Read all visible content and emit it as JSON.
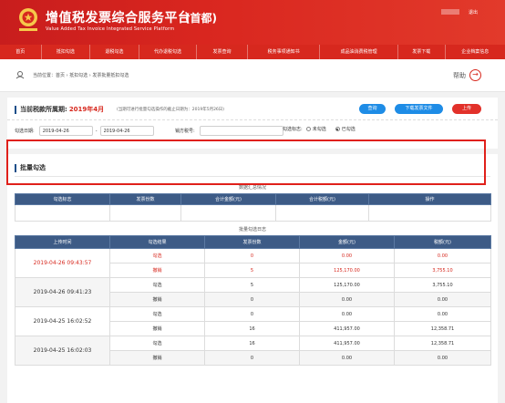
{
  "header": {
    "title": "增值税发票综合服务平台",
    "region": "(首都)",
    "subtitle": "Value Added Tax Invoice Integrated Service Platform",
    "logout": "退出"
  },
  "nav": [
    "首页",
    "抵扣勾选",
    "退税勾选",
    "代办退税勾选",
    "发票查询",
    "税务事项通知书",
    "成品油消费税管理",
    "发票下载",
    "企业档案信息"
  ],
  "breadcrumb": {
    "text": "当前位置：首页 › 抵扣勾选 › 发票批量抵扣勾选"
  },
  "help": {
    "label": "帮助"
  },
  "period": {
    "label": "当前税款所属期:",
    "value": "2019年4月",
    "note": "(当期可进行批量勾选操作的截止日期为：2019年5月26日)"
  },
  "buttons": {
    "query": "查询",
    "download": "下载发票文件",
    "upload": "上传"
  },
  "filters": {
    "date_label": "勾选日期:",
    "date_from": "2019-04-26",
    "date_to": "2019-04-26",
    "seller_label": "销方税号:",
    "flag_label": "勾选标志:",
    "opt_unchecked": "未勾选",
    "opt_checked": "已勾选"
  },
  "section": {
    "title": "批量勾选"
  },
  "summary": {
    "caption": "数据汇总情况",
    "headers": [
      "勾选标志",
      "发票份数",
      "合计金额(元)",
      "合计税额(元)",
      "操作"
    ]
  },
  "log": {
    "caption": "批量勾选日志",
    "headers": [
      "上传时间",
      "勾选结果",
      "发票份数",
      "金额(元)",
      "税额(元)"
    ],
    "groups": [
      {
        "time": "2019-04-26 09:43:57",
        "rows": [
          {
            "result": "勾选",
            "count": "0",
            "amount": "0.00",
            "tax": "0.00"
          },
          {
            "result": "撤销",
            "count": "5",
            "amount": "125,170.00",
            "tax": "3,755.10"
          }
        ]
      },
      {
        "time": "2019-04-26 09:41:23",
        "rows": [
          {
            "result": "勾选",
            "count": "5",
            "amount": "125,170.00",
            "tax": "3,755.10"
          },
          {
            "result": "撤销",
            "count": "0",
            "amount": "0.00",
            "tax": "0.00"
          }
        ]
      },
      {
        "time": "2019-04-25 16:02:52",
        "rows": [
          {
            "result": "勾选",
            "count": "0",
            "amount": "0.00",
            "tax": "0.00"
          },
          {
            "result": "撤销",
            "count": "16",
            "amount": "411,957.00",
            "tax": "12,358.71"
          }
        ]
      },
      {
        "time": "2019-04-25 16:02:03",
        "rows": [
          {
            "result": "勾选",
            "count": "16",
            "amount": "411,957.00",
            "tax": "12,358.71"
          },
          {
            "result": "撤销",
            "count": "0",
            "amount": "0.00",
            "tax": "0.00"
          }
        ]
      }
    ]
  },
  "colors": {
    "brand_red": "#d7281e",
    "header_blue": "#3d5b86",
    "button_blue": "#1e8ce6"
  }
}
